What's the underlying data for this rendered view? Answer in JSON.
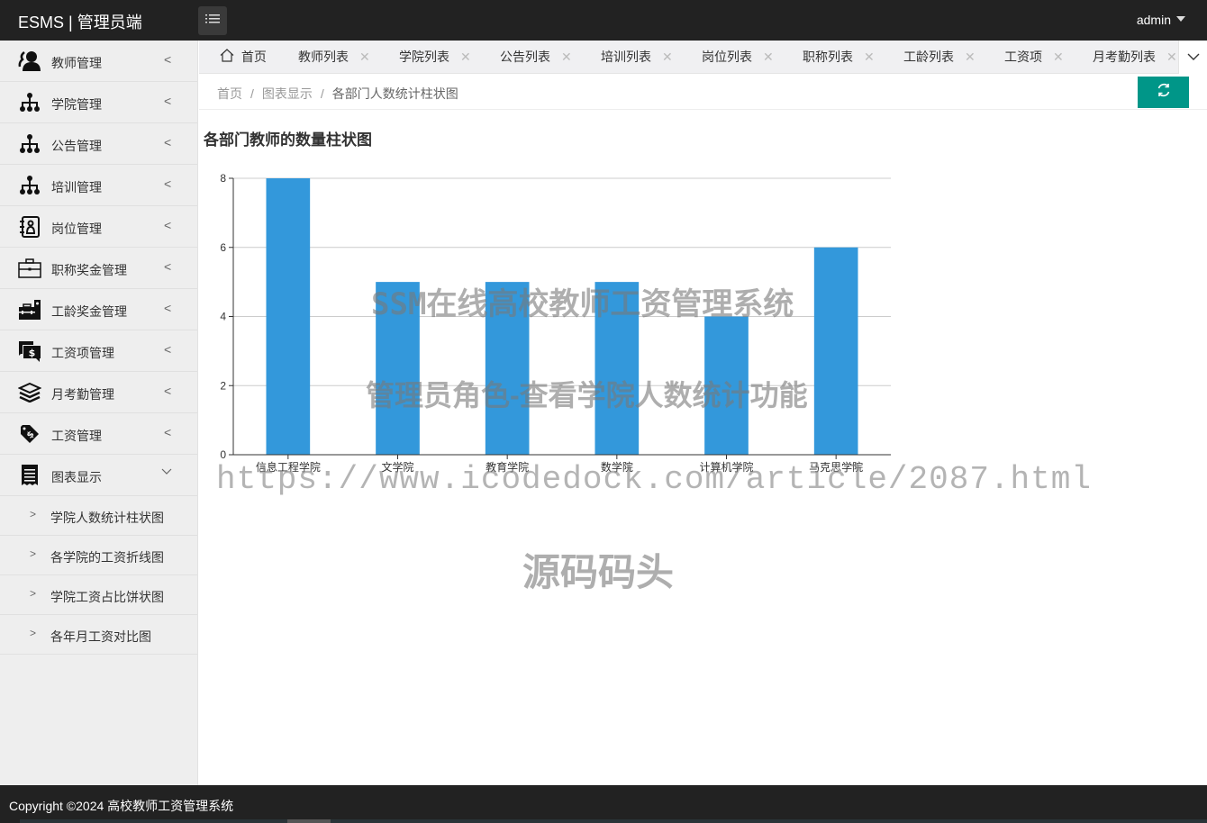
{
  "header": {
    "logo": "ESMS | 管理员端",
    "menu_toggle_icon": "list-icon",
    "user": "admin"
  },
  "sidebar": {
    "items": [
      {
        "label": "教师管理",
        "icon": "users-icon"
      },
      {
        "label": "学院管理",
        "icon": "sitemap-icon"
      },
      {
        "label": "公告管理",
        "icon": "sitemap-icon"
      },
      {
        "label": "培训管理",
        "icon": "sitemap-icon"
      },
      {
        "label": "岗位管理",
        "icon": "contact-book-icon"
      },
      {
        "label": "职称奖金管理",
        "icon": "briefcase-icon"
      },
      {
        "label": "工龄奖金管理",
        "icon": "toolbox-icon"
      },
      {
        "label": "工资项管理",
        "icon": "dollar-chat-icon"
      },
      {
        "label": "月考勤管理",
        "icon": "layers-icon"
      },
      {
        "label": "工资管理",
        "icon": "price-tag-icon"
      },
      {
        "label": "图表显示",
        "icon": "receipt-icon",
        "expanded": true
      }
    ],
    "sub_items": [
      {
        "label": "学院人数统计柱状图"
      },
      {
        "label": "各学院的工资折线图"
      },
      {
        "label": "学院工资占比饼状图"
      },
      {
        "label": "各年月工资对比图"
      }
    ]
  },
  "tabs": {
    "home": "首页",
    "items": [
      "教师列表",
      "学院列表",
      "公告列表",
      "培训列表",
      "岗位列表",
      "职称列表",
      "工龄列表",
      "工资项",
      "月考勤列表"
    ],
    "close_glyph": "✕",
    "more_icon": "chevron-down-icon"
  },
  "breadcrumb": {
    "items": [
      "首页",
      "图表显示",
      "各部门人数统计柱状图"
    ],
    "separator": "/",
    "refresh_icon": "refresh-icon",
    "accent": "#009688"
  },
  "watermarks": {
    "line1": "SSM在线高校教师工资管理系统",
    "line2": "管理员角色-查看学院人数统计功能",
    "line3": "https://www.icodedock.com/article/2087.html",
    "line4": "源码码头"
  },
  "footer": {
    "text": "Copyright ©2024 高校教师工资管理系统"
  },
  "chart_data": {
    "type": "bar",
    "title": "各部门教师的数量柱状图",
    "categories": [
      "信息工程学院",
      "文学院",
      "教育学院",
      "数学院",
      "计算机学院",
      "马克思学院"
    ],
    "values": [
      8,
      5,
      5,
      5,
      4,
      6
    ],
    "xlabel": "",
    "ylabel": "",
    "ylim": [
      0,
      8
    ],
    "yticks": [
      0,
      2,
      4,
      6,
      8
    ],
    "grid": true,
    "legend": "none",
    "bar_color": "#3398DB"
  }
}
